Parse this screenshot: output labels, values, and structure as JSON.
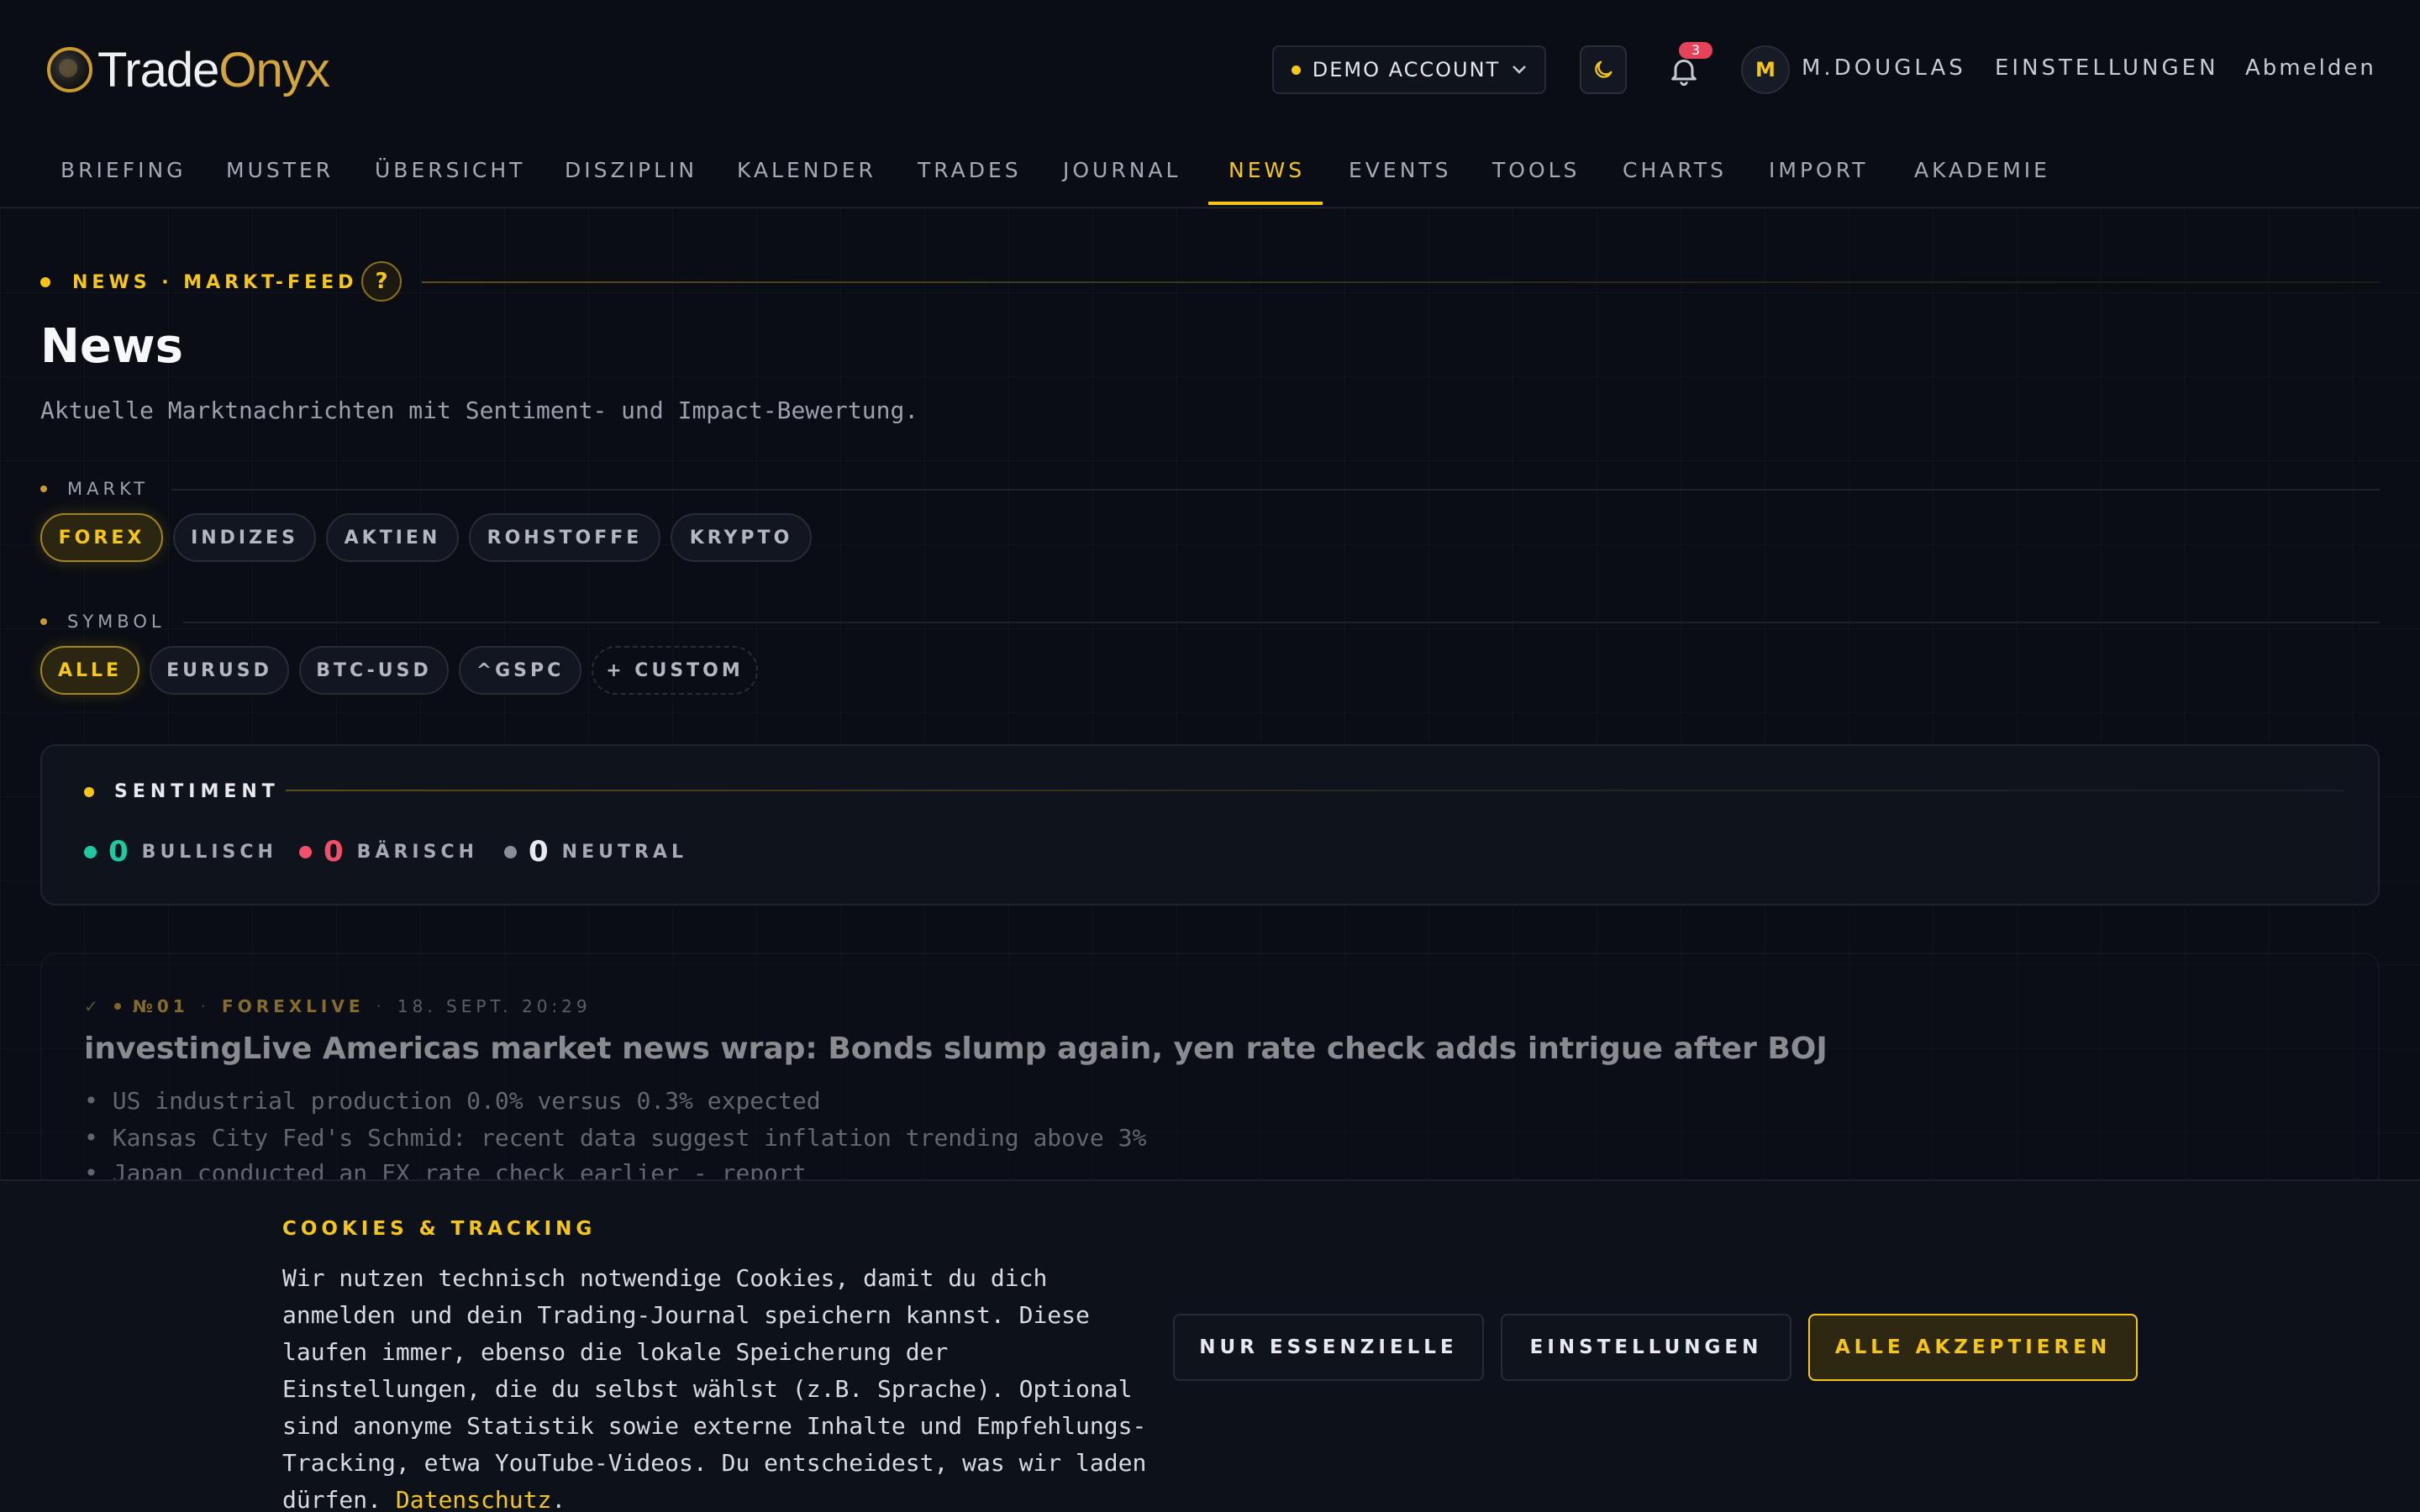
{
  "brand": {
    "name_a": "Trade",
    "name_b": "Onyx"
  },
  "header": {
    "account": "DEMO ACCOUNT",
    "notifications": "3",
    "avatar_initial": "M",
    "username": "M.DOUGLAS",
    "settings": "EINSTELLUNGEN",
    "logout": "Abmelden"
  },
  "nav": {
    "items": [
      "BRIEFING",
      "MUSTER",
      "ÜBERSICHT",
      "DISZIPLIN",
      "KALENDER",
      "TRADES",
      "JOURNAL",
      "NEWS",
      "EVENTS",
      "TOOLS",
      "CHARTS",
      "IMPORT",
      "AKADEMIE"
    ],
    "active": "NEWS"
  },
  "page": {
    "eyebrow": "NEWS · MARKT-FEED",
    "help": "?",
    "title": "News",
    "subtitle": "Aktuelle Marktnachrichten mit Sentiment- und Impact-Bewertung."
  },
  "filters": {
    "market_label": "MARKT",
    "markets": [
      "FOREX",
      "INDIZES",
      "AKTIEN",
      "ROHSTOFFE",
      "KRYPTO"
    ],
    "market_active": "FOREX",
    "symbol_label": "SYMBOL",
    "symbols": [
      "ALLE",
      "EURUSD",
      "BTC-USD",
      "^GSPC",
      "+ CUSTOM"
    ],
    "symbol_active": "ALLE"
  },
  "sentiment": {
    "title": "SENTIMENT",
    "bullish": {
      "count": "0",
      "label": "BULLISCH",
      "color": "#1fc9a0"
    },
    "bearish": {
      "count": "0",
      "label": "BÄRISCH",
      "color": "#f2506a"
    },
    "neutral": {
      "count": "0",
      "label": "NEUTRAL",
      "color": "#8a8e98"
    }
  },
  "news": [
    {
      "check": "✓",
      "number": "№01",
      "source": "FOREXLIVE",
      "time": "18. SEPT. 20:29",
      "title": "investingLive Americas market news wrap: Bonds slump again, yen rate check adds intrigue after BOJ",
      "bullets": [
        "• US industrial production 0.0% versus 0.3% expected",
        "• Kansas City Fed's Schmid: recent data suggest inflation trending above 3%",
        "• Japan conducted an FX rate check earlier - report"
      ]
    }
  ],
  "cookie": {
    "title": "COOKIES & TRACKING",
    "text": "Wir nutzen technisch notwendige Cookies, damit du dich anmelden und dein Trading-Journal speichern kannst. Diese laufen immer, ebenso die lokale Speicherung der Einstellungen, die du selbst wählst (z.B. Sprache). Optional sind anonyme Statistik sowie externe Inhalte und Empfehlungs-Tracking, etwa YouTube-Videos. Du entscheidest, was wir laden dürfen.",
    "link": "Datenschutz",
    "link_suffix": ".",
    "btn_essential": "NUR ESSENZIELLE",
    "btn_settings": "EINSTELLUNGEN",
    "btn_accept": "ALLE AKZEPTIEREN"
  },
  "colors": {
    "accent": "#f5c518",
    "bg": "#0a0d14"
  }
}
